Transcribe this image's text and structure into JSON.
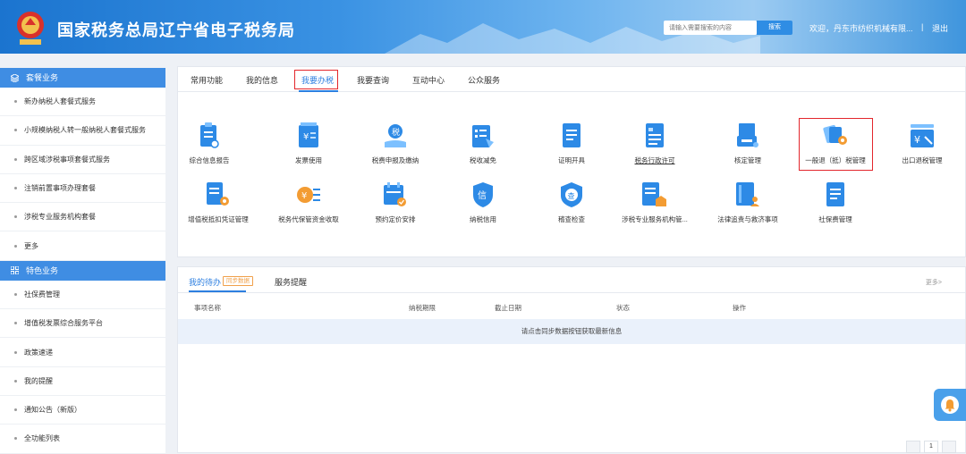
{
  "header": {
    "title": "国家税务总局辽宁省电子税务局",
    "search_placeholder": "请输入需要搜索的内容",
    "search_button": "搜索",
    "welcome": "欢迎，丹东市纺织机械有限...",
    "separator": "|",
    "logout": "退出"
  },
  "sidebar": {
    "section1": {
      "title": "套餐业务",
      "items": [
        "新办纳税人套餐式服务",
        "小规模纳税人转一般纳税人套餐式服务",
        "跨区域涉税事项套餐式服务",
        "注销前置事项办理套餐",
        "涉税专业服务机构套餐",
        "更多"
      ]
    },
    "section2": {
      "title": "特色业务",
      "items": [
        "社保费管理",
        "增值税发票综合服务平台",
        "政策速递",
        "我的提醒",
        "通知公告（新版）",
        "全功能列表"
      ]
    }
  },
  "main": {
    "tabs": [
      "常用功能",
      "我的信息",
      "我要办税",
      "我要查询",
      "互动中心",
      "公众服务"
    ],
    "active_tab": "我要办税",
    "icons": [
      "综合信息报告",
      "发票使用",
      "税费申报及缴纳",
      "税收减免",
      "证明开具",
      "税务行政许可",
      "核定管理",
      "一般退（抵）税管理",
      "出口退税管理",
      "增值税抵扣凭证管理",
      "税务代保管资金收取",
      "预约定价安排",
      "纳税信用",
      "稽查检查",
      "涉税专业服务机构管...",
      "法律追责与救济事项",
      "社保费管理"
    ]
  },
  "todo": {
    "tabs": [
      "我的待办",
      "服务提醒"
    ],
    "sync_badge": "同步数据",
    "more": "更多>",
    "columns": [
      "事项名称",
      "纳税期限",
      "截止日期",
      "状态",
      "操作"
    ],
    "empty_message": "请点击同步数据按钮获取最新信息",
    "page": "1"
  },
  "colors": {
    "primary": "#2d7fe0",
    "highlight": "#e3262c",
    "header": "#1b74cf"
  }
}
